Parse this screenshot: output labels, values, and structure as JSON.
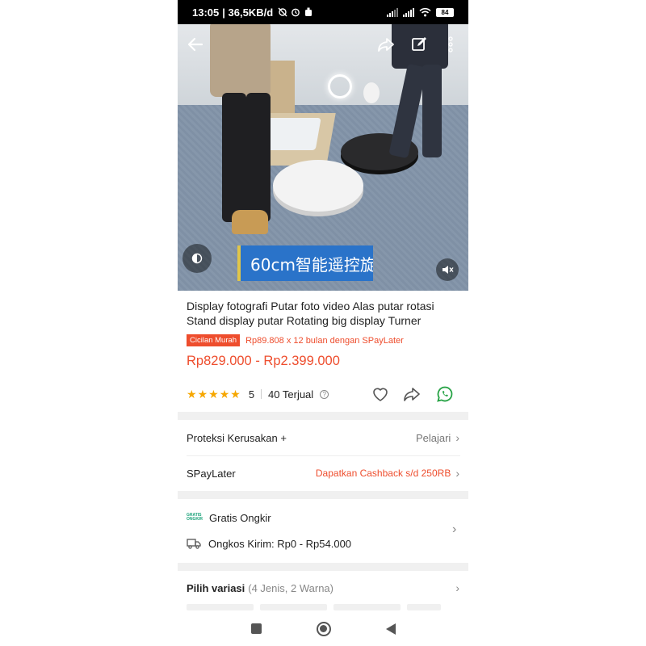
{
  "status_bar": {
    "time": "13:05",
    "network_speed": "| 36,5KB/d",
    "battery": "84"
  },
  "video": {
    "caption": "60cm智能遥控旋"
  },
  "product": {
    "title": "Display fotografi Putar foto video Alas putar rotasi Stand display putar Rotating big display Turner",
    "promo_badge": "Cicilan Murah",
    "promo_text": "Rp89.808 x 12 bulan dengan SPayLater",
    "price": "Rp829.000 - Rp2.399.000",
    "rating": "5",
    "sold": "40 Terjual"
  },
  "rows": {
    "protection_label": "Proteksi Kerusakan +",
    "protection_action": "Pelajari",
    "spaylater_label": "SPayLater",
    "spaylater_action": "Dapatkan Cashback s/d 250RB",
    "free_shipping_logo_line1": "GRATIS",
    "free_shipping_logo_line2": "ONGKIR",
    "free_shipping_label": "Gratis Ongkir",
    "shipping_cost": "Ongkos Kirim: Rp0 - Rp54.000",
    "variant_label": "Pilih variasi",
    "variant_detail": "(4 Jenis, 2 Warna)"
  },
  "icons": {
    "back": "arrow-left-icon",
    "share": "share-icon",
    "edit": "edit-icon",
    "more": "more-vertical-icon",
    "like": "heart-icon",
    "whatsapp": "whatsapp-icon"
  },
  "colors": {
    "accent": "#ee4d2d",
    "star": "#f6a700",
    "whatsapp": "#25a244"
  }
}
